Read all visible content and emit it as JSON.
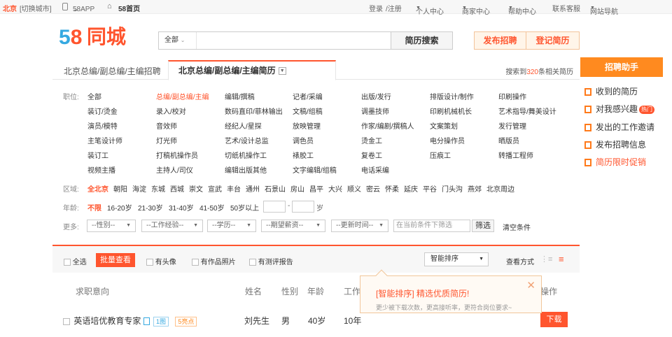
{
  "topbar": {
    "city": "北京",
    "switch_city": "[切换城市]",
    "app": "58APP",
    "home": "58首页",
    "login": "登录",
    "register": "/注册",
    "personal": "个人中心",
    "merchant": "商家中心",
    "help": "帮助中心",
    "service": "联系客服",
    "nav": "网站导航"
  },
  "header": {
    "logo_digits": [
      "5",
      "8"
    ],
    "logo_text": "同城",
    "search_category": "全部",
    "search_placeholder": "",
    "search_button": "简历搜索",
    "post_job": "发布招聘",
    "register_resume": "登记简历"
  },
  "tabs": {
    "tab1": "北京总编/副总编/主编招聘",
    "tab2": "北京总编/副总编/主编简历",
    "found_prefix": "搜索到",
    "found_count": "320",
    "found_suffix": "条相关简历"
  },
  "filters": {
    "position_label": "职位:",
    "positions": [
      [
        "全部",
        "总编/副总编/主编",
        "编辑/撰稿",
        "记者/采编",
        "出版/发行",
        "排版设计/制作",
        "印刷操作"
      ],
      [
        "装订/烫金",
        "录入/校对",
        "数码直印/菲林输出",
        "文稿/组稿",
        "调墨技师",
        "印刷机械机长",
        "艺术指导/舞美设计"
      ],
      [
        "演员/模特",
        "音效师",
        "经纪人/星探",
        "放映管理",
        "作家/编剧/撰稿人",
        "文案策划",
        "发行管理"
      ],
      [
        "主笔设计师",
        "灯光师",
        "艺术/设计总监",
        "调色员",
        "烫金工",
        "电分操作员",
        "晒版员"
      ],
      [
        "装订工",
        "打稿机操作员",
        "切纸机操作工",
        "裱胶工",
        "复卷工",
        "压痕工",
        "转播工程师"
      ],
      [
        "视频主播",
        "主持人/司仪",
        "编辑出版其他",
        "文字编辑/组稿",
        "电话采编"
      ]
    ],
    "area_label": "区域:",
    "areas": [
      "全北京",
      "朝阳",
      "海淀",
      "东城",
      "西城",
      "崇文",
      "宣武",
      "丰台",
      "通州",
      "石景山",
      "房山",
      "昌平",
      "大兴",
      "顺义",
      "密云",
      "怀柔",
      "延庆",
      "平谷",
      "门头沟",
      "燕郊",
      "北京周边"
    ],
    "age_label": "年龄:",
    "ages": [
      "不限",
      "16-20岁",
      "21-30岁",
      "31-40岁",
      "41-50岁",
      "50岁以上"
    ],
    "age_dash": "-",
    "age_unit": "岁",
    "more_label": "更多:",
    "more_dropdowns": [
      "--性别--",
      "--工作经验--",
      "--学历--",
      "--期望薪资--",
      "--更新时间--"
    ],
    "condition_placeholder": "在当前条件下筛选",
    "filter_button": "筛选",
    "clear_button": "清空条件"
  },
  "results": {
    "select_all": "全选",
    "batch_view": "批量查看",
    "has_photo": "有头像",
    "has_works": "有作品照片",
    "has_report": "有测评报告",
    "sort": "智能排序",
    "view_mode": "查看方式",
    "columns": [
      "求职意向",
      "姓名",
      "性别",
      "年龄",
      "工作",
      "操作"
    ],
    "rows": [
      {
        "intent": "英语培优教育专家",
        "photos": "1图",
        "highlights": "5亮点",
        "name": "刘先生",
        "gender": "男",
        "age": "40岁",
        "work": "10年",
        "action": "下载"
      }
    ]
  },
  "popup": {
    "title": "[智能排序] 精选优质简历!",
    "subtitle": "更少被下载次数，更高接听率，更符合岗位要求~",
    "close": "✕"
  },
  "sidebar": {
    "title": "招聘助手",
    "items": [
      "收到的简历",
      "对我感兴趣",
      "发出的工作邀请",
      "发布招聘信息",
      "简历限时促销"
    ],
    "hot_badge": "热门"
  },
  "colors": {
    "accent": "#ff552e",
    "sidebar_header": "#ff8a1f",
    "logo_blue": "#36a9e1"
  }
}
